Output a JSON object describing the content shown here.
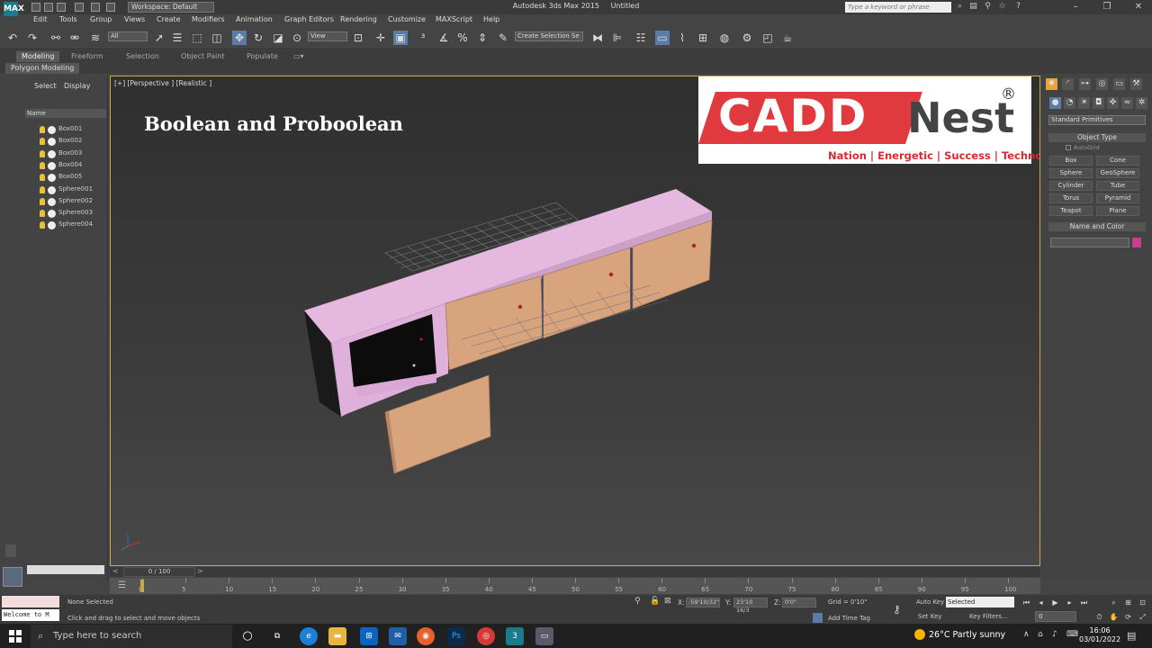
{
  "app": {
    "title": "Autodesk 3ds Max  2015",
    "document": "Untitled",
    "workspace": "Workspace: Default",
    "search_placeholder": "Type a keyword or phrase",
    "logo_text": "MAX"
  },
  "menu": [
    "Edit",
    "Tools",
    "Group",
    "Views",
    "Create",
    "Modifiers",
    "Animation",
    "Graph Editors",
    "Rendering",
    "Customize",
    "MAXScript",
    "Help"
  ],
  "toolbar": {
    "selection_filter": "All",
    "ref_coord": "View",
    "named_selection": "Create Selection Se"
  },
  "ribbon": {
    "tabs": [
      "Modeling",
      "Freeform",
      "Selection",
      "Object Paint",
      "Populate"
    ],
    "active": "Modeling",
    "subtab": "Polygon Modeling"
  },
  "explorer": {
    "tabs": [
      "Select",
      "Display"
    ],
    "column_header": "Name",
    "objects": [
      "Box001",
      "Box002",
      "Box003",
      "Box004",
      "Box005",
      "Sphere001",
      "Sphere002",
      "Sphere003",
      "Sphere004"
    ]
  },
  "viewport": {
    "label": "[+] [Perspective ] [Realistic ]",
    "heading": "Boolean and Proboolean"
  },
  "brand": {
    "name_part1": "CADD",
    "name_part2": "Nest",
    "registered": "®",
    "tagline": "Nation | Energetic  | Success | Technology"
  },
  "command_panel": {
    "category": "Standard Primitives",
    "object_type_header": "Object Type",
    "autogrid": "AutoGrid",
    "buttons": [
      "Box",
      "Cone",
      "Sphere",
      "GeoSphere",
      "Cylinder",
      "Tube",
      "Torus",
      "Pyramid",
      "Teapot",
      "Plane"
    ],
    "name_color_header": "Name and Color",
    "object_color": "#c6408e"
  },
  "timeline": {
    "frame_display": "0 / 100",
    "ticks": [
      "0",
      "5",
      "10",
      "15",
      "20",
      "25",
      "30",
      "35",
      "40",
      "45",
      "50",
      "55",
      "60",
      "65",
      "70",
      "75",
      "80",
      "85",
      "90",
      "95",
      "100"
    ]
  },
  "status": {
    "listener_text": "Welcome to M",
    "selection_info": "None Selected",
    "prompt": "Click and drag to select and move objects",
    "x_label": "X:",
    "x_value": "-59'10/32\"",
    "y_label": "Y:",
    "y_value": "23'10 16/3",
    "z_label": "Z:",
    "z_value": "0'0\"",
    "grid": "Grid = 0'10\"",
    "add_time_tag": "Add Time Tag",
    "auto_key": "Auto Key",
    "set_key": "Set Key",
    "key_mode": "Selected",
    "key_filters": "Key Filters...",
    "current_frame": "0"
  },
  "taskbar": {
    "search_placeholder": "Type here to search",
    "weather": "26°C  Partly sunny",
    "time": "16:06",
    "date": "03/01/2022",
    "ps_label": "Ps"
  },
  "colors": {
    "viewport_border": "#c8a84a",
    "cabinet_top": "#e5b8e0",
    "door": "#d8a47e",
    "brand_red": "#e03a3f"
  }
}
